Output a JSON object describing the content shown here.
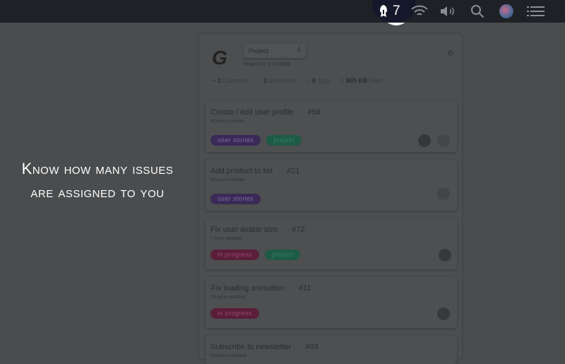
{
  "menubar": {
    "count": "7",
    "icons": [
      "spartan-helmet-icon",
      "wifi-icon",
      "volume-icon",
      "search-icon",
      "siri-icon",
      "list-icon"
    ]
  },
  "headline": {
    "line1": "Know how many issues",
    "line2": "are assigned to you"
  },
  "project": {
    "select": "Project",
    "id": "Project ID: 17819009",
    "stats": [
      {
        "n": "2",
        "l": "Commits"
      },
      {
        "n": "2",
        "l": "Branches"
      },
      {
        "n": "0",
        "l": "Tags"
      },
      {
        "n": "809 KB",
        "l": "Files"
      }
    ]
  },
  "issues": [
    {
      "title": "Create / edit user profile",
      "num": "#56",
      "sub": "42 jours restants",
      "tags": [
        "user stories",
        "project"
      ]
    },
    {
      "title": "Add product to list",
      "num": "#21",
      "sub": "89 jours restants",
      "tags": [
        "user stories"
      ]
    },
    {
      "title": "Fix user avatar size",
      "num": "#72",
      "sub": "7 jours restants",
      "tags": [
        "in progress",
        "project"
      ]
    },
    {
      "title": "Fix loading animation",
      "num": "#11",
      "sub": "22 jours restatnts",
      "tags": [
        "in progress"
      ]
    },
    {
      "title": "Subscribe to newsletter",
      "num": "#03",
      "sub": "208 jours restants",
      "tags": []
    }
  ],
  "colors": {
    "purple": "#3b2a57",
    "green": "#1f5a45",
    "red": "#5b1e3a"
  }
}
